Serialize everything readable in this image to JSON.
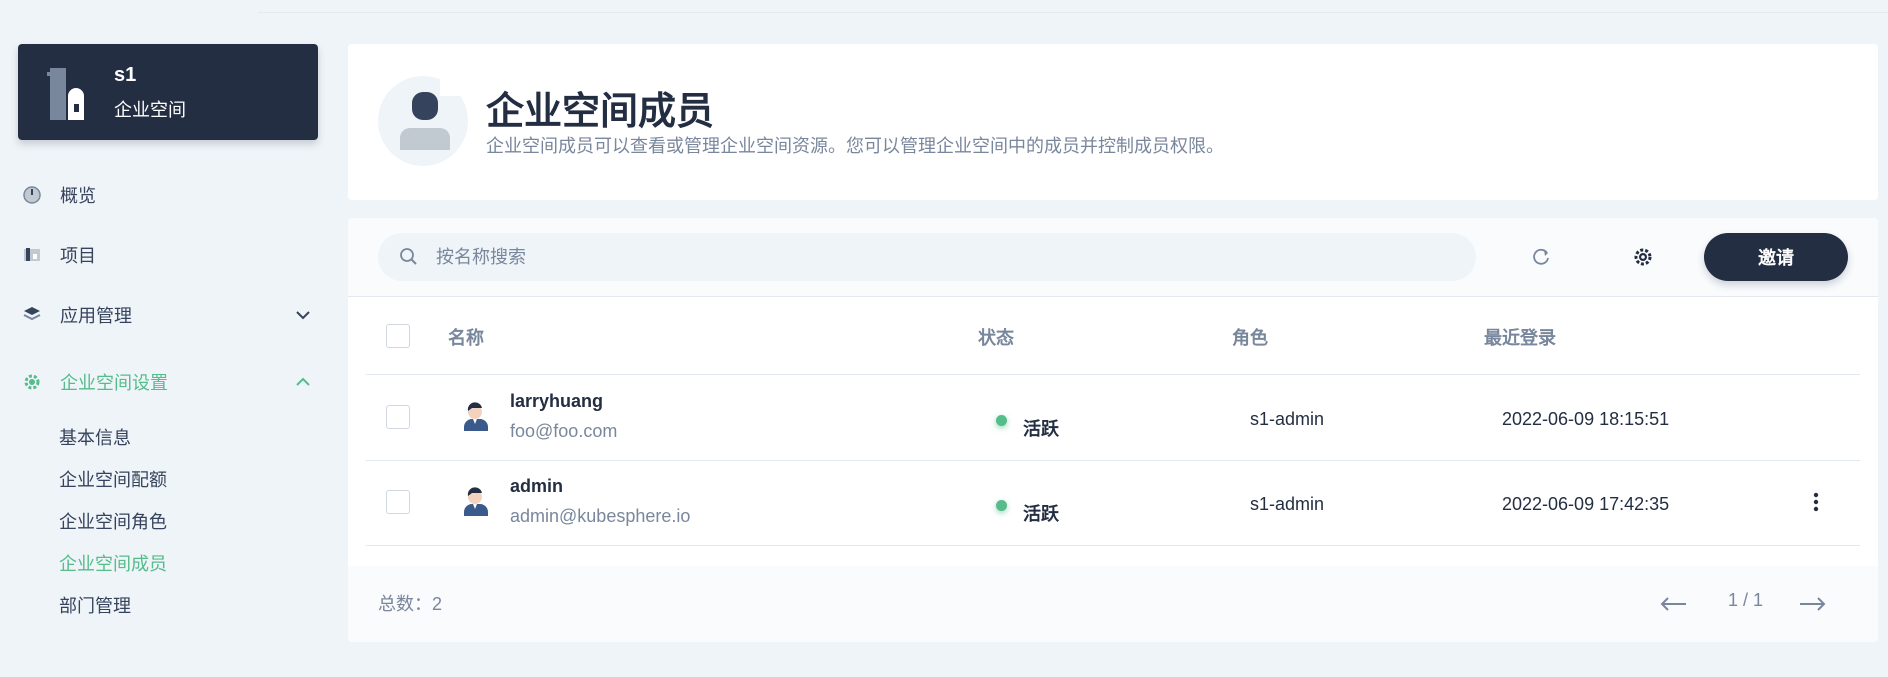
{
  "workspace": {
    "name": "s1",
    "type": "企业空间"
  },
  "sidebar": {
    "items": [
      {
        "label": "概览",
        "icon": "dashboard-icon"
      },
      {
        "label": "项目",
        "icon": "project-icon"
      },
      {
        "label": "应用管理",
        "icon": "appstore-icon",
        "expanded": false
      },
      {
        "label": "企业空间设置",
        "icon": "gear-icon",
        "expanded": true
      }
    ],
    "subitems": [
      {
        "label": "基本信息"
      },
      {
        "label": "企业空间配额"
      },
      {
        "label": "企业空间角色"
      },
      {
        "label": "企业空间成员",
        "active": true
      },
      {
        "label": "部门管理"
      }
    ]
  },
  "header": {
    "title": "企业空间成员",
    "description": "企业空间成员可以查看或管理企业空间资源。您可以管理企业空间中的成员并控制成员权限。"
  },
  "toolbar": {
    "search_placeholder": "按名称搜索",
    "invite_label": "邀请"
  },
  "table": {
    "columns": [
      "名称",
      "状态",
      "角色",
      "最近登录"
    ],
    "rows": [
      {
        "name": "larryhuang",
        "email": "foo@foo.com",
        "status": "活跃",
        "role": "s1-admin",
        "last_login": "2022-06-09 18:15:51"
      },
      {
        "name": "admin",
        "email": "admin@kubesphere.io",
        "status": "活跃",
        "role": "s1-admin",
        "last_login": "2022-06-09 17:42:35"
      }
    ]
  },
  "footer": {
    "total": "总数：2",
    "page": "1 / 1"
  },
  "colors": {
    "accent": "#55bc8a",
    "dark": "#242e42",
    "muted": "#79879c",
    "background": "#eff4f9"
  }
}
